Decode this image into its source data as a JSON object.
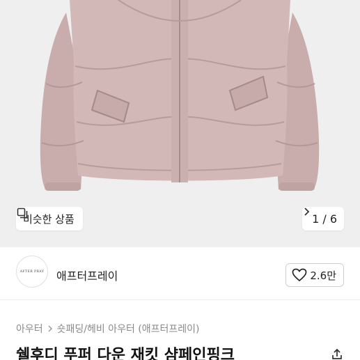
{
  "gallery": {
    "similar_label": "비슷한 상품",
    "pager_text": "1 / 6",
    "current_index": 1,
    "total_images": 6
  },
  "shop": {
    "logo_text": "AFTER PRAY",
    "name": "애프터프레이",
    "like_count": "2.6만"
  },
  "breadcrumb": {
    "items": [
      "아우터",
      "숏패딩/헤비 아우터 (애프터프레이)"
    ]
  },
  "product": {
    "title": "쉘후디 푸퍼 다운 재킷 샴페인핑크"
  },
  "icons": {
    "similar": "similar-products-icon",
    "next": "chevron-right-icon",
    "like": "heart-outline-icon",
    "breadcrumb_sep": "chevron-right-icon",
    "share": "share-icon"
  },
  "colors": {
    "jacket": "#cfb3b3",
    "hero_bg": "#efefef",
    "text": "#222222",
    "muted": "#8a8a8a"
  }
}
